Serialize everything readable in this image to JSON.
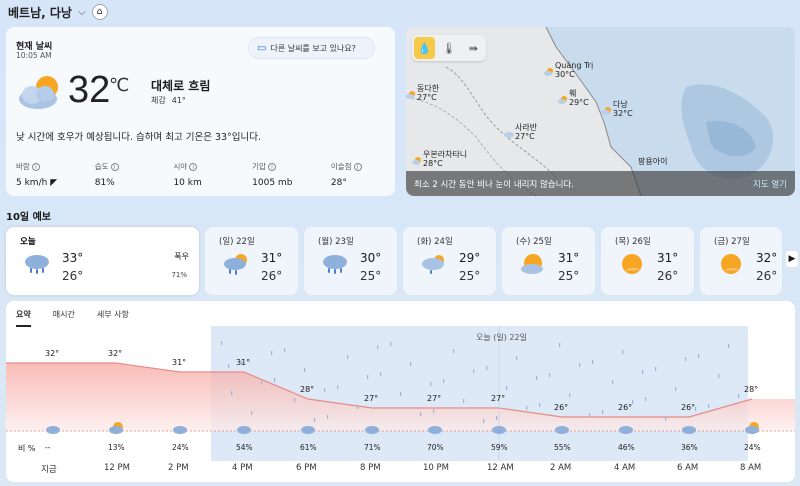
{
  "header": {
    "location": "베트남, 다낭"
  },
  "current": {
    "title": "현재 날씨",
    "time": "10:05 AM",
    "ask": "다른 날씨를 보고 있나요?",
    "temp": "32",
    "unit": "℃",
    "condition": "대체로 흐림",
    "feels_label": "체감",
    "feels": "41°",
    "desc": "낮 시간에 호우가 예상됩니다. 습하며 최고 기온은 33°입니다.",
    "stats": [
      {
        "label": "바람",
        "value": "5 km/h"
      },
      {
        "label": "습도",
        "value": "81%"
      },
      {
        "label": "시야",
        "value": "10 km"
      },
      {
        "label": "기압",
        "value": "1005 mb"
      },
      {
        "label": "이슬점",
        "value": "28°"
      }
    ]
  },
  "map": {
    "cities": [
      {
        "name": "Quảng Trị",
        "temp": "30°C"
      },
      {
        "name": "동다한",
        "temp": "27°C"
      },
      {
        "name": "훼",
        "temp": "29°C"
      },
      {
        "name": "다낭",
        "temp": "32°C"
      },
      {
        "name": "사라반",
        "temp": "27°C"
      },
      {
        "name": "우본라차타니",
        "temp": "28°C"
      },
      {
        "name": "팡용아이",
        "temp": ""
      }
    ],
    "message": "최소 2 시간 동안 비나 눈이 내리지 않습니다.",
    "open": "지도 열기"
  },
  "forecast": {
    "title": "10일 예보",
    "days": [
      {
        "name": "오늘",
        "hi": "33°",
        "lo": "26°",
        "cond": "폭우",
        "pct": "71%",
        "icon": "rain"
      },
      {
        "name": "(일) 22일",
        "hi": "31°",
        "lo": "26°",
        "icon": "rain-sun"
      },
      {
        "name": "(월) 23일",
        "hi": "30°",
        "lo": "25°",
        "icon": "rain"
      },
      {
        "name": "(화) 24일",
        "hi": "29°",
        "lo": "25°",
        "icon": "rain-cloud"
      },
      {
        "name": "(수) 25일",
        "hi": "31°",
        "lo": "25°",
        "icon": "partly-sunny"
      },
      {
        "name": "(목) 26일",
        "hi": "31°",
        "lo": "26°",
        "icon": "sunny"
      },
      {
        "name": "(금) 27일",
        "hi": "32°",
        "lo": "26°",
        "icon": "sunny"
      }
    ]
  },
  "hourly": {
    "tabs": [
      "요약",
      "매시간",
      "세부 사항"
    ],
    "day_marker": "오늘   (일) 22일",
    "rain_label": "비 %",
    "temps": [
      32,
      32,
      31,
      31,
      28,
      27,
      27,
      27,
      26,
      26,
      26,
      28
    ],
    "temp_labels": [
      "32°",
      "32°",
      "31°",
      "31°",
      "28°",
      "27°",
      "27°",
      "27°",
      "26°",
      "26°",
      "26°",
      "28°"
    ],
    "rain": [
      "--",
      "13%",
      "24%",
      "54%",
      "61%",
      "71%",
      "70%",
      "59%",
      "55%",
      "46%",
      "36%",
      "24%"
    ],
    "times": [
      "지금",
      "12 PM",
      "2 PM",
      "4 PM",
      "6 PM",
      "8 PM",
      "10 PM",
      "12 AM",
      "2 AM",
      "4 AM",
      "6 AM",
      "8 AM"
    ]
  }
}
